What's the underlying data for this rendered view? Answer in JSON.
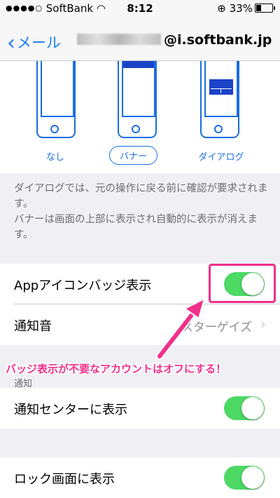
{
  "status": {
    "carrier": "SoftBank",
    "dots": "●●●●○",
    "time": "8:12",
    "battery": "33%"
  },
  "nav": {
    "back_label": "メール",
    "title_suffix": "@i.softbank.jp"
  },
  "alert_styles": {
    "none": "なし",
    "banner": "バナー",
    "dialog": "ダイアログ",
    "selected": "banner"
  },
  "description": {
    "line1": "ダイアログでは、元の操作に戻る前に確認が要求されます。",
    "line2": "バナーは画面の上部に表示され自動的に表示が消えます。"
  },
  "rows": {
    "badge": {
      "label": "Appアイコンバッジ表示",
      "on": true
    },
    "sound": {
      "label": "通知音",
      "value": "スターゲイズ"
    },
    "notif_section_header": "通知",
    "notification_center": {
      "label": "通知センターに表示",
      "on": true
    },
    "lock_screen": {
      "label": "ロック画面に表示",
      "on": true
    }
  },
  "annotation": {
    "text": "バッジ表示が不要なアカウントはオフにする！",
    "color": "#f0308a"
  },
  "colors": {
    "accent": "#1a7cf9",
    "toggle_on": "#4cd964",
    "annotation": "#f0308a"
  }
}
